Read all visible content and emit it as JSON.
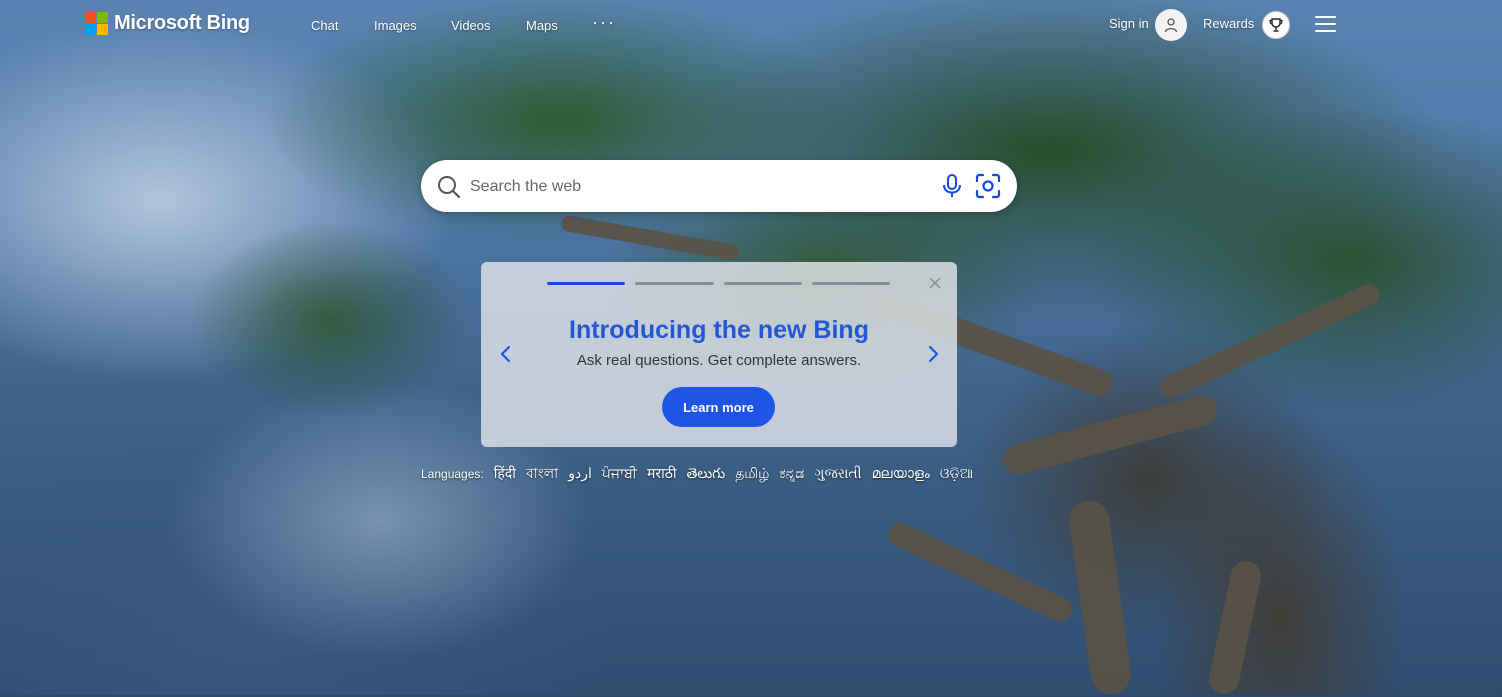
{
  "brand": {
    "name": "Microsoft Bing",
    "colors": {
      "red": "#f25022",
      "green": "#7fba00",
      "blue": "#00a4ef",
      "yellow": "#ffb900"
    }
  },
  "nav": {
    "items": [
      {
        "label": "Chat"
      },
      {
        "label": "Images"
      },
      {
        "label": "Videos"
      },
      {
        "label": "Maps"
      },
      {
        "label": "···"
      }
    ]
  },
  "account": {
    "signin_label": "Sign in",
    "avatar_icon": "person-icon",
    "rewards_label": "Rewards",
    "rewards_icon": "trophy-icon",
    "menu_icon": "hamburger-icon"
  },
  "search": {
    "placeholder": "Search the web",
    "value": "",
    "search_icon": "search-icon",
    "voice_icon": "microphone-icon",
    "visual_icon": "visual-search-icon",
    "icon_color": "#174ae4"
  },
  "carousel": {
    "slide_count": 4,
    "active_index": 0,
    "title": "Introducing the new Bing",
    "subtitle": "Ask real questions. Get complete answers.",
    "button_label": "Learn more",
    "accent": "#2457d6"
  },
  "languages": {
    "label": "Languages:",
    "items": [
      "हिंदी",
      "বাংলা",
      "اردو",
      "ਪੰਜਾਬੀ",
      "मराठी",
      "తెలుగు",
      "தமிழ்",
      "ಕನ್ನಡ",
      "ગુજરાતી",
      "മലയാളം",
      "ଓଡ଼ିଆ"
    ]
  }
}
